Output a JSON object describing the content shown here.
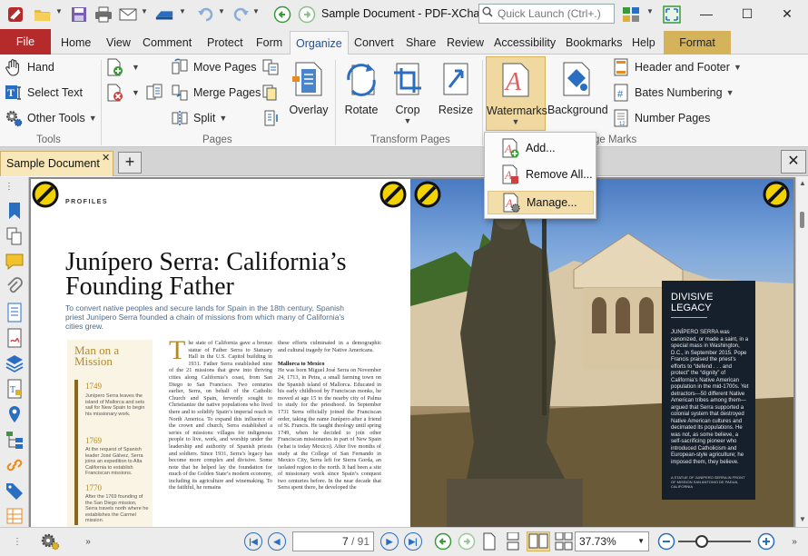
{
  "window": {
    "title": "Sample Document - PDF-XCha...",
    "quick_launch_placeholder": "Quick Launch (Ctrl+.)"
  },
  "ribbon_tabs": [
    "File",
    "Home",
    "View",
    "Comment",
    "Protect",
    "Form",
    "Organize",
    "Convert",
    "Share",
    "Review",
    "Accessibility",
    "Bookmarks",
    "Help",
    "Format"
  ],
  "active_tab": "Organize",
  "groups": {
    "tools": {
      "label": "Tools",
      "hand": "Hand",
      "select_text": "Select Text",
      "other_tools": "Other Tools"
    },
    "pages": {
      "label": "Pages",
      "move_pages": "Move Pages",
      "merge_pages": "Merge Pages",
      "split": "Split",
      "overlay": "Overlay"
    },
    "transform": {
      "label": "Transform Pages",
      "rotate": "Rotate",
      "crop": "Crop",
      "resize": "Resize"
    },
    "page_marks": {
      "label": "ge Marks",
      "watermarks": "Watermarks",
      "background": "Background",
      "header_footer": "Header and Footer",
      "bates": "Bates Numbering",
      "page_numbers": "Number Pages"
    }
  },
  "watermark_menu": {
    "add": "Add...",
    "remove_all": "Remove All...",
    "manage": "Manage..."
  },
  "doc_tab": {
    "name": "Sample Document"
  },
  "page_left": {
    "kicker": "PROFILES",
    "headline": "Junípero Serra: California’s Founding Father",
    "subhead": "To convert native peoples and secure lands for Spain in the 18th century, Spanish priest Junípero Serra founded a chain of missions from which many of California’s cities grew.",
    "sidebox_title": "Man on a Mission",
    "timeline": [
      {
        "year": "1749",
        "text": "Junípero Serra leaves the island of Mallorca and sets sail for New Spain to begin his missionary work."
      },
      {
        "year": "1769",
        "text": "At the request of Spanish leader José Gálvez, Serra joins an expedition to Alta California to establish Franciscan missions."
      },
      {
        "year": "1770",
        "text": "After the 1769 founding of the San Diego mission, Serra travels north where he establishes the Carmel mission."
      }
    ],
    "col1": "he state of California gave a bronze statue of Father Serra to Statuary Hall in the U.S. Capitol building in 1931. Father Serra established nine of the 21 missions that grew into thriving cities along California’s coast, from San Diego to San Francisco. Two centuries earlier, Serra, on behalf of the Catholic Church and Spain, fervently sought to Christianize the native populations who lived there and to solidify Spain’s imperial reach in North America. To expand this influence of the crown and church, Serra established a series of missions: villages for indigenous people to live, work, and worship under the leadership and authority of Spanish priests and soldiers. Since 1931, Serra’s legacy has become more complex and divisive. Some note that he helped lay the foundation for much of the Golden State’s modern economy, including its agriculture and winemaking. To the faithful, he remains",
    "col2_intro": "these efforts culminated in a demographic and cultural tragedy for Native Americans.",
    "col2_head": "Mallorca to Mexico",
    "col2": "He was born Miguel José Serra on November 24, 1713, in Petra, a small farming town on the Spanish island of Mallorca. Educated in his early childhood by Franciscan monks, he moved at age 15 to the nearby city of Palma to study for the priesthood. In September 1731 Serra officially joined the Franciscan order, taking the name Junípero after a friend of St. Francis. He taught theology until spring 1749, when he decided to join other Franciscan missionaries in part of New Spain (what is today Mexico). After five months of study at the College of San Fernando in Mexico City, Serra left for Sierra Gorda, an isolated region to the north. It had been a site of missionary work since Spain’s conquest two centuries before. In the near decade that Serra spent there, he developed the"
  },
  "page_right": {
    "inset_title": "DIVISIVE LEGACY",
    "inset_body": "JUNÍPERO SERRA was canonized, or made a saint, in a special mass in Washington, D.C., in September 2015. Pope Francis praised the priest’s efforts to “defend . . . and protect” the “dignity” of California’s Native American population in the mid-1700s. Yet detractors—50 different Native American tribes among them—argued that Serra supported a colonial system that destroyed Native American cultures and decimated its populations. He was not, as some believe, a self-sacrificing pioneer who introduced Catholicism and European-style agriculture; he imposed them, they believe.",
    "inset_caption": "A STATUE OF JUNÍPERO SERRA IN FRONT OF MISSION SAN ANTONIO DE PADUA, CALIFORNIA"
  },
  "statusbar": {
    "page_current": "7",
    "page_total": "/ 91",
    "zoom": "37.73%"
  },
  "colors": {
    "file_tab": "#b52a2a",
    "format_tab": "#d4b35a",
    "doc_tab": "#f8e7b8",
    "accent_blue": "#2a6ec2",
    "highlight": "#f3deaa"
  },
  "zoom_slider_level": 0.28
}
